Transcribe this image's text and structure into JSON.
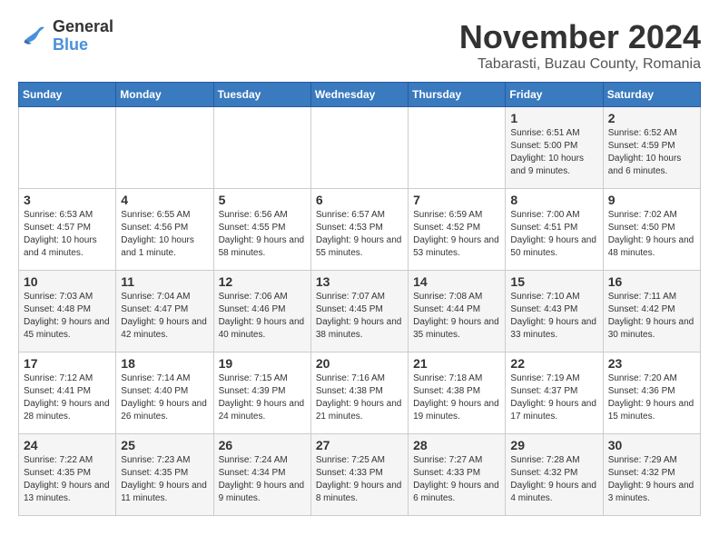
{
  "logo": {
    "general": "General",
    "blue": "Blue"
  },
  "title": "November 2024",
  "location": "Tabarasti, Buzau County, Romania",
  "weekdays": [
    "Sunday",
    "Monday",
    "Tuesday",
    "Wednesday",
    "Thursday",
    "Friday",
    "Saturday"
  ],
  "weeks": [
    [
      {
        "day": "",
        "info": ""
      },
      {
        "day": "",
        "info": ""
      },
      {
        "day": "",
        "info": ""
      },
      {
        "day": "",
        "info": ""
      },
      {
        "day": "",
        "info": ""
      },
      {
        "day": "1",
        "info": "Sunrise: 6:51 AM\nSunset: 5:00 PM\nDaylight: 10 hours and 9 minutes."
      },
      {
        "day": "2",
        "info": "Sunrise: 6:52 AM\nSunset: 4:59 PM\nDaylight: 10 hours and 6 minutes."
      }
    ],
    [
      {
        "day": "3",
        "info": "Sunrise: 6:53 AM\nSunset: 4:57 PM\nDaylight: 10 hours and 4 minutes."
      },
      {
        "day": "4",
        "info": "Sunrise: 6:55 AM\nSunset: 4:56 PM\nDaylight: 10 hours and 1 minute."
      },
      {
        "day": "5",
        "info": "Sunrise: 6:56 AM\nSunset: 4:55 PM\nDaylight: 9 hours and 58 minutes."
      },
      {
        "day": "6",
        "info": "Sunrise: 6:57 AM\nSunset: 4:53 PM\nDaylight: 9 hours and 55 minutes."
      },
      {
        "day": "7",
        "info": "Sunrise: 6:59 AM\nSunset: 4:52 PM\nDaylight: 9 hours and 53 minutes."
      },
      {
        "day": "8",
        "info": "Sunrise: 7:00 AM\nSunset: 4:51 PM\nDaylight: 9 hours and 50 minutes."
      },
      {
        "day": "9",
        "info": "Sunrise: 7:02 AM\nSunset: 4:50 PM\nDaylight: 9 hours and 48 minutes."
      }
    ],
    [
      {
        "day": "10",
        "info": "Sunrise: 7:03 AM\nSunset: 4:48 PM\nDaylight: 9 hours and 45 minutes."
      },
      {
        "day": "11",
        "info": "Sunrise: 7:04 AM\nSunset: 4:47 PM\nDaylight: 9 hours and 42 minutes."
      },
      {
        "day": "12",
        "info": "Sunrise: 7:06 AM\nSunset: 4:46 PM\nDaylight: 9 hours and 40 minutes."
      },
      {
        "day": "13",
        "info": "Sunrise: 7:07 AM\nSunset: 4:45 PM\nDaylight: 9 hours and 38 minutes."
      },
      {
        "day": "14",
        "info": "Sunrise: 7:08 AM\nSunset: 4:44 PM\nDaylight: 9 hours and 35 minutes."
      },
      {
        "day": "15",
        "info": "Sunrise: 7:10 AM\nSunset: 4:43 PM\nDaylight: 9 hours and 33 minutes."
      },
      {
        "day": "16",
        "info": "Sunrise: 7:11 AM\nSunset: 4:42 PM\nDaylight: 9 hours and 30 minutes."
      }
    ],
    [
      {
        "day": "17",
        "info": "Sunrise: 7:12 AM\nSunset: 4:41 PM\nDaylight: 9 hours and 28 minutes."
      },
      {
        "day": "18",
        "info": "Sunrise: 7:14 AM\nSunset: 4:40 PM\nDaylight: 9 hours and 26 minutes."
      },
      {
        "day": "19",
        "info": "Sunrise: 7:15 AM\nSunset: 4:39 PM\nDaylight: 9 hours and 24 minutes."
      },
      {
        "day": "20",
        "info": "Sunrise: 7:16 AM\nSunset: 4:38 PM\nDaylight: 9 hours and 21 minutes."
      },
      {
        "day": "21",
        "info": "Sunrise: 7:18 AM\nSunset: 4:38 PM\nDaylight: 9 hours and 19 minutes."
      },
      {
        "day": "22",
        "info": "Sunrise: 7:19 AM\nSunset: 4:37 PM\nDaylight: 9 hours and 17 minutes."
      },
      {
        "day": "23",
        "info": "Sunrise: 7:20 AM\nSunset: 4:36 PM\nDaylight: 9 hours and 15 minutes."
      }
    ],
    [
      {
        "day": "24",
        "info": "Sunrise: 7:22 AM\nSunset: 4:35 PM\nDaylight: 9 hours and 13 minutes."
      },
      {
        "day": "25",
        "info": "Sunrise: 7:23 AM\nSunset: 4:35 PM\nDaylight: 9 hours and 11 minutes."
      },
      {
        "day": "26",
        "info": "Sunrise: 7:24 AM\nSunset: 4:34 PM\nDaylight: 9 hours and 9 minutes."
      },
      {
        "day": "27",
        "info": "Sunrise: 7:25 AM\nSunset: 4:33 PM\nDaylight: 9 hours and 8 minutes."
      },
      {
        "day": "28",
        "info": "Sunrise: 7:27 AM\nSunset: 4:33 PM\nDaylight: 9 hours and 6 minutes."
      },
      {
        "day": "29",
        "info": "Sunrise: 7:28 AM\nSunset: 4:32 PM\nDaylight: 9 hours and 4 minutes."
      },
      {
        "day": "30",
        "info": "Sunrise: 7:29 AM\nSunset: 4:32 PM\nDaylight: 9 hours and 3 minutes."
      }
    ]
  ]
}
